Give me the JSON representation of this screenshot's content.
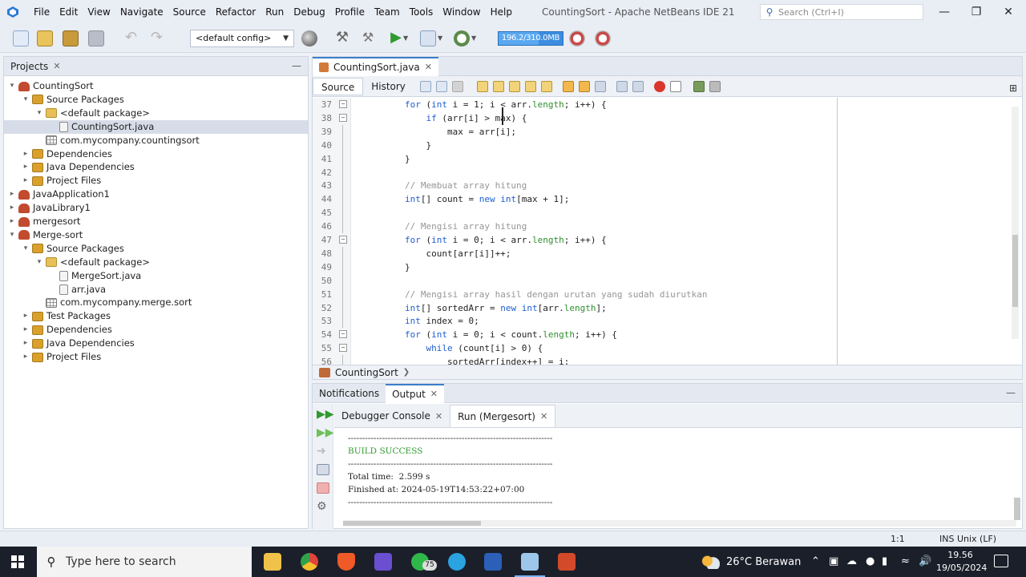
{
  "menubar": {
    "items": [
      "File",
      "Edit",
      "View",
      "Navigate",
      "Source",
      "Refactor",
      "Run",
      "Debug",
      "Profile",
      "Team",
      "Tools",
      "Window",
      "Help"
    ],
    "window_title": "CountingSort - Apache NetBeans IDE 21",
    "search_placeholder": "Search (Ctrl+I)",
    "minimize": "—",
    "maximize": "❐",
    "close": "✕"
  },
  "toolbar": {
    "config": "<default config>",
    "memory": "196.2/310.0MB",
    "memory_fraction": 0.63
  },
  "projects": {
    "tab_label": "Projects",
    "tree": [
      {
        "label": "CountingSort",
        "depth": 0,
        "icon": "project",
        "toggle": "▾"
      },
      {
        "label": "Source Packages",
        "depth": 1,
        "icon": "folder-pkg",
        "toggle": "▾"
      },
      {
        "label": "<default package>",
        "depth": 2,
        "icon": "package",
        "toggle": "▾"
      },
      {
        "label": "CountingSort.java",
        "depth": 3,
        "icon": "file",
        "toggle": "",
        "selected": true
      },
      {
        "label": "com.mycompany.countingsort",
        "depth": 2,
        "icon": "package-grid",
        "toggle": ""
      },
      {
        "label": "Dependencies",
        "depth": 1,
        "icon": "folder-pkg",
        "toggle": "▸"
      },
      {
        "label": "Java Dependencies",
        "depth": 1,
        "icon": "folder-pkg",
        "toggle": "▸"
      },
      {
        "label": "Project Files",
        "depth": 1,
        "icon": "folder-pkg",
        "toggle": "▸"
      },
      {
        "label": "JavaApplication1",
        "depth": 0,
        "icon": "project",
        "toggle": "▸"
      },
      {
        "label": "JavaLibrary1",
        "depth": 0,
        "icon": "project",
        "toggle": "▸"
      },
      {
        "label": "mergesort",
        "depth": 0,
        "icon": "project",
        "toggle": "▸"
      },
      {
        "label": "Merge-sort",
        "depth": 0,
        "icon": "project",
        "toggle": "▾"
      },
      {
        "label": "Source Packages",
        "depth": 1,
        "icon": "folder-pkg",
        "toggle": "▾"
      },
      {
        "label": "<default package>",
        "depth": 2,
        "icon": "package",
        "toggle": "▾"
      },
      {
        "label": "MergeSort.java",
        "depth": 3,
        "icon": "file",
        "toggle": ""
      },
      {
        "label": "arr.java",
        "depth": 3,
        "icon": "file",
        "toggle": ""
      },
      {
        "label": "com.mycompany.merge.sort",
        "depth": 2,
        "icon": "package-grid",
        "toggle": ""
      },
      {
        "label": "Test Packages",
        "depth": 1,
        "icon": "folder-pkg",
        "toggle": "▸"
      },
      {
        "label": "Dependencies",
        "depth": 1,
        "icon": "folder-pkg",
        "toggle": "▸"
      },
      {
        "label": "Java Dependencies",
        "depth": 1,
        "icon": "folder-pkg",
        "toggle": "▸"
      },
      {
        "label": "Project Files",
        "depth": 1,
        "icon": "folder-pkg",
        "toggle": "▸"
      }
    ]
  },
  "editor": {
    "tab_label": "CountingSort.java",
    "source_label": "Source",
    "history_label": "History",
    "breadcrumb": "CountingSort",
    "lines": [
      {
        "n": "37",
        "fold": "−",
        "tokens": [
          [
            "",
            "        "
          ],
          [
            "kw",
            "for"
          ],
          [
            "",
            " ("
          ],
          [
            "kw",
            "int"
          ],
          [
            "",
            " i = 1; i < arr."
          ],
          [
            "fld",
            "length"
          ],
          [
            "",
            "; i++) {"
          ]
        ]
      },
      {
        "n": "38",
        "fold": "−",
        "tokens": [
          [
            "",
            "            "
          ],
          [
            "kw",
            "if"
          ],
          [
            "",
            " (arr[i] > max) {"
          ]
        ]
      },
      {
        "n": "39",
        "fold": "",
        "tokens": [
          [
            "",
            "                max = arr[i];"
          ]
        ]
      },
      {
        "n": "40",
        "fold": "",
        "tokens": [
          [
            "",
            "            }"
          ]
        ]
      },
      {
        "n": "41",
        "fold": "",
        "tokens": [
          [
            "",
            "        }"
          ]
        ]
      },
      {
        "n": "42",
        "fold": "",
        "tokens": [
          [
            "",
            ""
          ]
        ]
      },
      {
        "n": "43",
        "fold": "",
        "tokens": [
          [
            "",
            "        "
          ],
          [
            "cm",
            "// Membuat array hitung"
          ]
        ]
      },
      {
        "n": "44",
        "fold": "",
        "tokens": [
          [
            "",
            "        "
          ],
          [
            "kw",
            "int"
          ],
          [
            "",
            "[] count = "
          ],
          [
            "kw",
            "new"
          ],
          [
            "",
            " "
          ],
          [
            "kw",
            "int"
          ],
          [
            "",
            "[max + 1];"
          ]
        ]
      },
      {
        "n": "45",
        "fold": "",
        "tokens": [
          [
            "",
            ""
          ]
        ]
      },
      {
        "n": "46",
        "fold": "",
        "tokens": [
          [
            "",
            "        "
          ],
          [
            "cm",
            "// Mengisi array hitung"
          ]
        ]
      },
      {
        "n": "47",
        "fold": "−",
        "tokens": [
          [
            "",
            "        "
          ],
          [
            "kw",
            "for"
          ],
          [
            "",
            " ("
          ],
          [
            "kw",
            "int"
          ],
          [
            "",
            " i = 0; i < arr."
          ],
          [
            "fld",
            "length"
          ],
          [
            "",
            "; i++) {"
          ]
        ]
      },
      {
        "n": "48",
        "fold": "",
        "tokens": [
          [
            "",
            "            count[arr[i]]++;"
          ]
        ]
      },
      {
        "n": "49",
        "fold": "",
        "tokens": [
          [
            "",
            "        }"
          ]
        ]
      },
      {
        "n": "50",
        "fold": "",
        "tokens": [
          [
            "",
            ""
          ]
        ]
      },
      {
        "n": "51",
        "fold": "",
        "tokens": [
          [
            "",
            "        "
          ],
          [
            "cm",
            "// Mengisi array hasil dengan urutan yang sudah diurutkan"
          ]
        ]
      },
      {
        "n": "52",
        "fold": "",
        "tokens": [
          [
            "",
            "        "
          ],
          [
            "kw",
            "int"
          ],
          [
            "",
            "[] sortedArr = "
          ],
          [
            "kw",
            "new"
          ],
          [
            "",
            " "
          ],
          [
            "kw",
            "int"
          ],
          [
            "",
            "[arr."
          ],
          [
            "fld",
            "length"
          ],
          [
            "",
            "];"
          ]
        ]
      },
      {
        "n": "53",
        "fold": "",
        "tokens": [
          [
            "",
            "        "
          ],
          [
            "kw",
            "int"
          ],
          [
            "",
            " index = 0;"
          ]
        ]
      },
      {
        "n": "54",
        "fold": "−",
        "tokens": [
          [
            "",
            "        "
          ],
          [
            "kw",
            "for"
          ],
          [
            "",
            " ("
          ],
          [
            "kw",
            "int"
          ],
          [
            "",
            " i = 0; i < count."
          ],
          [
            "fld",
            "length"
          ],
          [
            "",
            "; i++) {"
          ]
        ]
      },
      {
        "n": "55",
        "fold": "−",
        "tokens": [
          [
            "",
            "            "
          ],
          [
            "kw",
            "while"
          ],
          [
            "",
            " (count[i] > 0) {"
          ]
        ]
      },
      {
        "n": "56",
        "fold": "",
        "tokens": [
          [
            "",
            "                sortedArr[index++] = i;"
          ]
        ]
      }
    ]
  },
  "output": {
    "notifications_label": "Notifications",
    "output_label": "Output",
    "debugger_label": "Debugger Console",
    "run_label": "Run (Mergesort)",
    "lines": [
      {
        "text": "------------------------------------------------------------------------",
        "cls": ""
      },
      {
        "text": "BUILD SUCCESS",
        "cls": "success"
      },
      {
        "text": "------------------------------------------------------------------------",
        "cls": ""
      },
      {
        "text": "Total time:  2.599 s",
        "cls": ""
      },
      {
        "text": "Finished at: 2024-05-19T14:53:22+07:00",
        "cls": ""
      },
      {
        "text": "------------------------------------------------------------------------",
        "cls": ""
      }
    ]
  },
  "status": {
    "position": "1:1",
    "mode": "INS  Unix (LF)"
  },
  "taskbar": {
    "search_placeholder": "Type here to search",
    "badge": "75",
    "weather": "26°C  Berawan",
    "time": "19.56",
    "date": "19/05/2024"
  }
}
